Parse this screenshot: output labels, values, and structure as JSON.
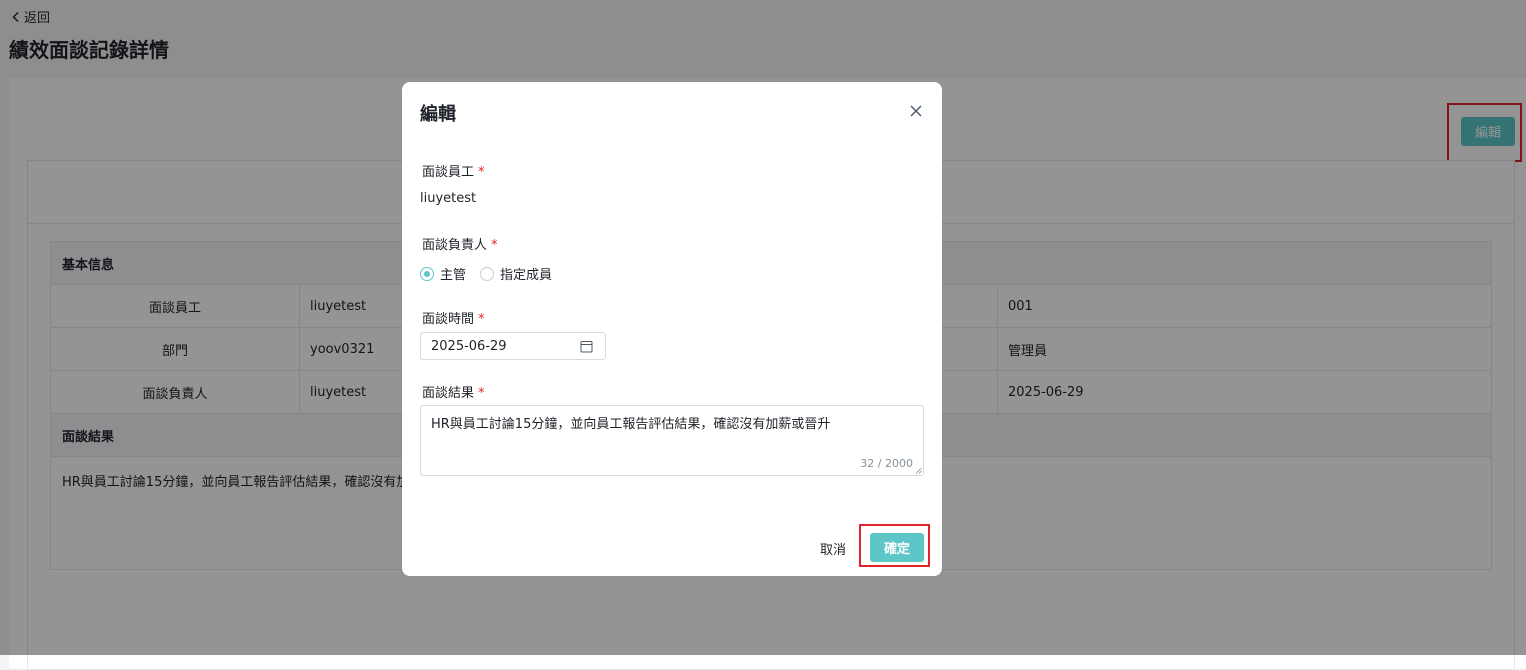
{
  "header": {
    "back_label": "返回",
    "page_title": "績效面談記錄詳情"
  },
  "toolbar": {
    "edit_label": "編輯"
  },
  "info": {
    "section_basic": "基本信息",
    "rows": [
      {
        "label": "面談員工",
        "value": "liuyetest",
        "value2": "001"
      },
      {
        "label": "部門",
        "value": "yoov0321",
        "value2": "管理員"
      },
      {
        "label": "面談負責人",
        "value": "liuyetest",
        "value2": "2025-06-29"
      }
    ],
    "section_result": "面談結果",
    "result_text": "HR與員工討論15分鐘，並向員工報告評估結果，確認沒有加薪或晉升"
  },
  "modal": {
    "title": "編輯",
    "employee_label": "面談員工",
    "employee_value": "liuyetest",
    "owner_label": "面談負責人",
    "owner_options": [
      "主管",
      "指定成員"
    ],
    "owner_selected": "主管",
    "time_label": "面談時間",
    "time_value": "2025-06-29",
    "result_label": "面談結果",
    "result_value": "HR與員工討論15分鐘，並向員工報告評估結果，確認沒有加薪或晉升",
    "result_count": "32 / 2000",
    "required_mark": "*",
    "cancel_label": "取消",
    "ok_label": "確定"
  },
  "colors": {
    "accent": "#5cc6c9",
    "highlight": "#e0242b",
    "required": "#e0242b"
  }
}
